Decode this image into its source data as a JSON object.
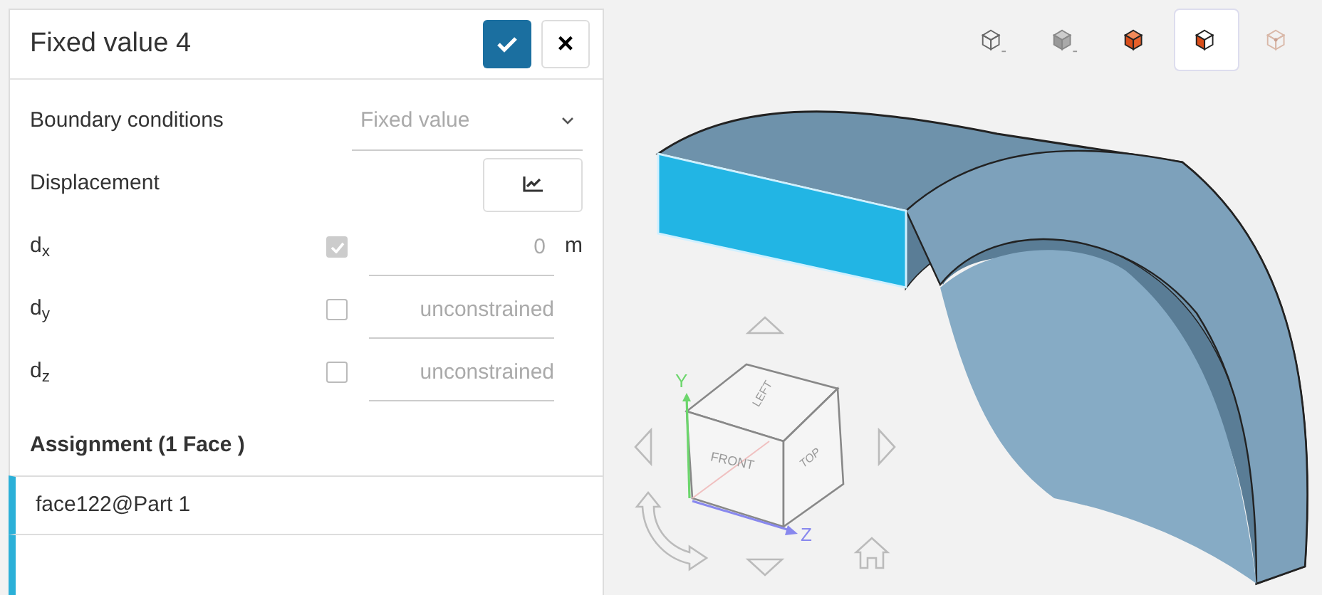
{
  "panel": {
    "title": "Fixed value 4",
    "close_button": {
      "label": "×"
    },
    "boundary_conditions": {
      "label": "Boundary conditions",
      "value": "Fixed value"
    },
    "displacement": {
      "label": "Displacement"
    },
    "components": [
      {
        "label": "d$_{x}$",
        "checked": true,
        "disabled": true,
        "value": "0",
        "unit": "m"
      },
      {
        "label": "d$_{y}$",
        "checked": false,
        "disabled": false,
        "placeholder": "unconstrained"
      },
      {
        "label": "d$_{z}$",
        "checked": false,
        "disabled": false,
        "placeholder": "unconstrained"
      }
    ],
    "assignment": {
      "heading": "Assignment (1 Face )",
      "items": [
        {
          "label": "face122@Part 1",
          "selected": true
        }
      ]
    }
  },
  "viewport": {
    "view_buttons": [
      {
        "kind": "wire",
        "selected": false
      },
      {
        "kind": "solid",
        "selected": false
      },
      {
        "kind": "solid-edges",
        "selected": false
      },
      {
        "kind": "half",
        "selected": true
      },
      {
        "kind": "points",
        "selected": false
      }
    ],
    "nav_cube": {
      "top_face": "LEFT",
      "front_face": "FRONT",
      "side_face": "TOP",
      "y_axis": "Y",
      "z_axis": "Z"
    }
  }
}
